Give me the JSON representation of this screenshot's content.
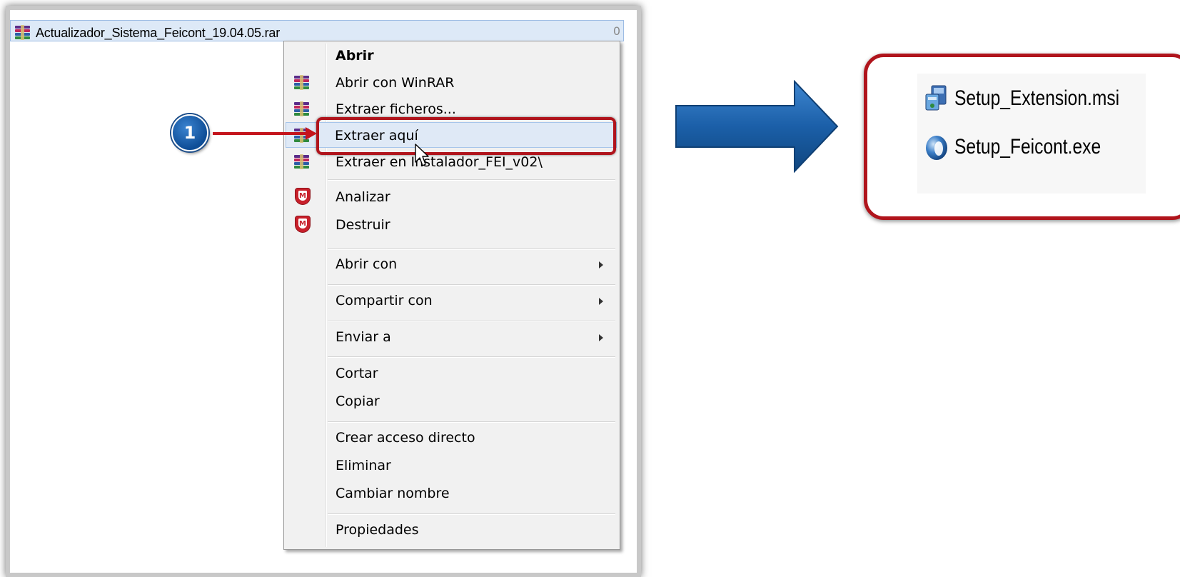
{
  "file": {
    "name": "Actualizador_Sistema_Feicont_19.04.05.rar",
    "column_fragment": "0",
    "icon": "winrar-icon"
  },
  "context_menu": {
    "items": [
      {
        "label": "Abrir",
        "bold": true,
        "icon": "none"
      },
      {
        "label": "Abrir con WinRAR",
        "icon": "winrar-icon"
      },
      {
        "label": "Extraer ficheros...",
        "icon": "winrar-icon"
      },
      {
        "label": "Extraer aquí",
        "icon": "winrar-icon",
        "highlighted": true
      },
      {
        "label": "Extraer en Instalador_FEI_v02\\",
        "icon": "winrar-icon"
      },
      {
        "label": "Analizar",
        "icon": "mcafee-icon"
      },
      {
        "label": "Destruir",
        "icon": "mcafee-icon"
      },
      {
        "label": "Abrir con",
        "submenu": true
      },
      {
        "label": "Compartir con",
        "submenu": true
      },
      {
        "label": "Enviar a",
        "submenu": true
      },
      {
        "label": "Cortar"
      },
      {
        "label": "Copiar"
      },
      {
        "label": "Crear acceso directo"
      },
      {
        "label": "Eliminar"
      },
      {
        "label": "Cambiar nombre"
      },
      {
        "label": "Propiedades"
      }
    ]
  },
  "step_badge": {
    "number": "1"
  },
  "result": {
    "files": [
      {
        "name": "Setup_Extension.msi",
        "icon": "msi-installer-icon"
      },
      {
        "name": "Setup_Feicont.exe",
        "icon": "setup-exe-icon"
      }
    ]
  },
  "colors": {
    "highlight_red": "#b0141c",
    "arrow_blue": "#1b5fa8",
    "badge_blue": "#0e4d96",
    "selection_blue": "#dde9f7"
  }
}
